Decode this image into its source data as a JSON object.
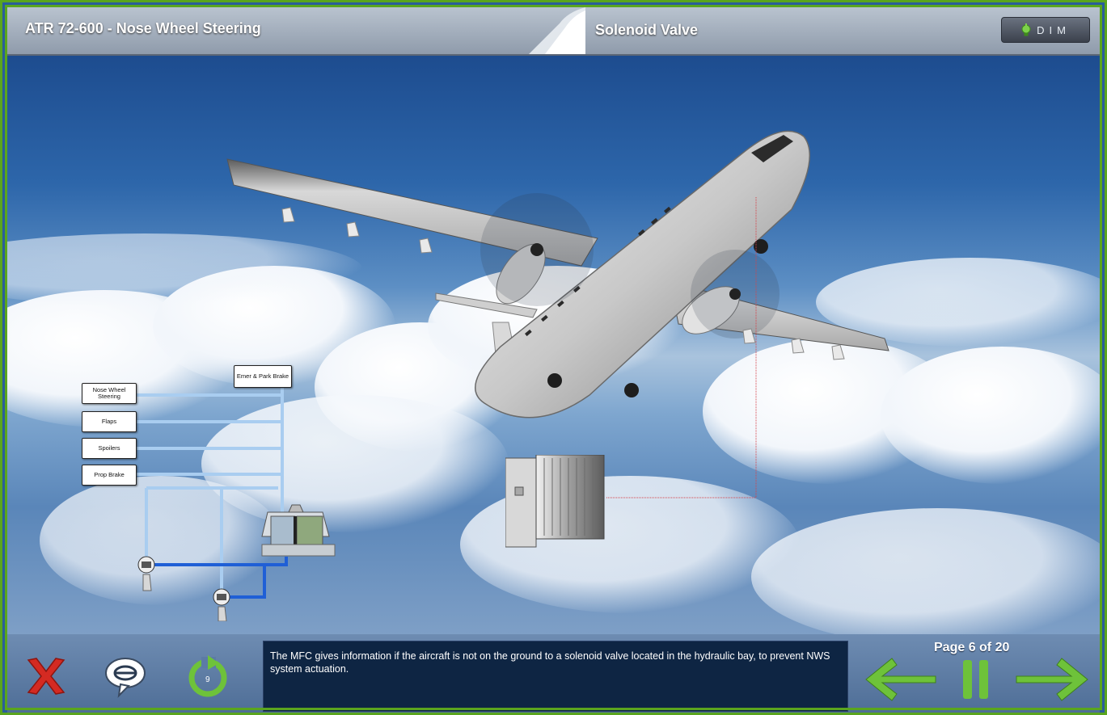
{
  "header": {
    "course_title": "ATR 72-600 - Nose Wheel Steering",
    "page_title": "Solenoid Valve",
    "dim_label": "DIM"
  },
  "diagram": {
    "labels": [
      "Nose Wheel Steering",
      "Flaps",
      "Spoilers",
      "Prop Brake",
      "Emer & Park Brake"
    ]
  },
  "caption": {
    "text": "The MFC gives information if the aircraft is not on the ground to a solenoid valve located in the hydraulic bay, to prevent NWS system actuation."
  },
  "navigation": {
    "page_indicator": "Page 6 of 20"
  },
  "icons": {
    "exit": "close-icon",
    "transcript": "speech-bubble-icon",
    "replay": "replay-icon",
    "back": "arrow-left-icon",
    "pause": "pause-icon",
    "next": "arrow-right-icon",
    "dim": "bulb-icon"
  },
  "colors": {
    "frame_green": "#5aa51e",
    "button_green": "#6ec23a",
    "exit_red": "#d42a22",
    "caption_bg": "#0e2543",
    "hydraulic_light": "#a9cdf0",
    "hydraulic_dark": "#1f5fd6"
  }
}
